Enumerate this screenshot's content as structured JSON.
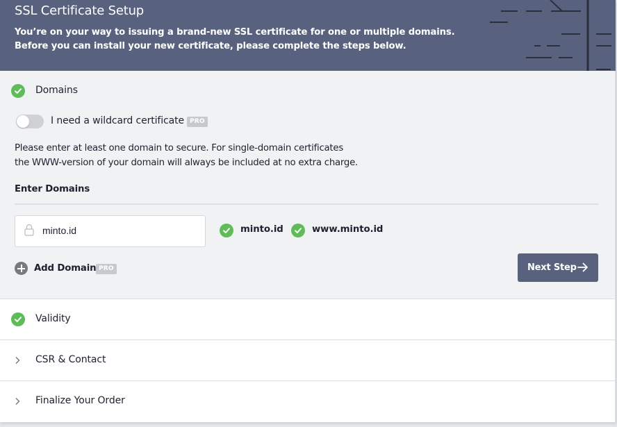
{
  "header": {
    "title": "SSL Certificate Setup",
    "description_line1": "You’re on your way to issuing a brand-new SSL certificate for one or multiple domains.",
    "description_line2": "Before you can install your new certificate, please complete the steps below."
  },
  "colors": {
    "header_bg": "#58627f",
    "success": "#5fbd57",
    "button_bg": "#58627f",
    "badge_bg": "#c7c9cd",
    "section_bg": "#f1f2f4"
  },
  "domains_step": {
    "title": "Domains",
    "status_icon": "check-circle-icon",
    "wildcard_toggle": {
      "label": "I need a wildcard certificate",
      "enabled": false,
      "badge": "PRO"
    },
    "info_line1": "Please enter at least one domain to secure. For single-domain certificates",
    "info_line2": "the WWW-version of your domain will always be included at no extra charge.",
    "enter_label": "Enter Domains",
    "input": {
      "value": "minto.id",
      "icon": "lock-icon"
    },
    "validated_domains": [
      "minto.id",
      "www.minto.id"
    ],
    "add_domain": {
      "label": "Add Domain",
      "badge": "PRO",
      "icon": "plus-circle-icon"
    },
    "next_button": {
      "label": "Next Step",
      "icon": "arrow-right-icon"
    }
  },
  "steps": [
    {
      "title": "Validity",
      "state": "completed",
      "icon": "check-circle-icon"
    },
    {
      "title": "CSR & Contact",
      "state": "collapsed",
      "icon": "chevron-right-icon"
    },
    {
      "title": "Finalize Your Order",
      "state": "collapsed",
      "icon": "chevron-right-icon"
    }
  ]
}
